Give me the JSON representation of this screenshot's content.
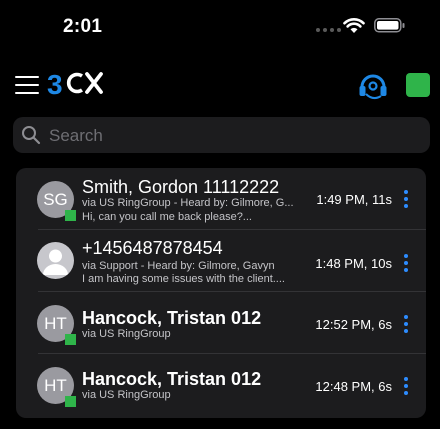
{
  "status_bar": {
    "time": "2:01"
  },
  "header": {
    "logo_text": "3CX",
    "status_color": "#2fb44a"
  },
  "search": {
    "placeholder": "Search"
  },
  "calls": [
    {
      "initials": "SG",
      "name": "Smith, Gordon 11112222",
      "via": "via US RingGroup - Heard by: Gilmore, G...",
      "message": "Hi, can you call me back please?...",
      "time": "1:49 PM, 11s",
      "presence": "available"
    },
    {
      "initials": "",
      "name": "+1456487878454",
      "via": "via Support - Heard by: Gilmore, Gavyn",
      "message": "I am having some issues with the client....",
      "time": "1:48 PM, 10s",
      "presence": "none"
    },
    {
      "initials": "HT",
      "name": "Hancock, Tristan 012",
      "via": "via US RingGroup",
      "message": "",
      "time": "12:52 PM, 6s",
      "presence": "available"
    },
    {
      "initials": "HT",
      "name": "Hancock, Tristan 012",
      "via": "via US RingGroup",
      "message": "",
      "time": "12:48 PM, 6s",
      "presence": "available"
    }
  ],
  "colors": {
    "accent": "#2d8cff",
    "available": "#2fb44a",
    "background": "#000000",
    "card": "#1c1c1e"
  }
}
